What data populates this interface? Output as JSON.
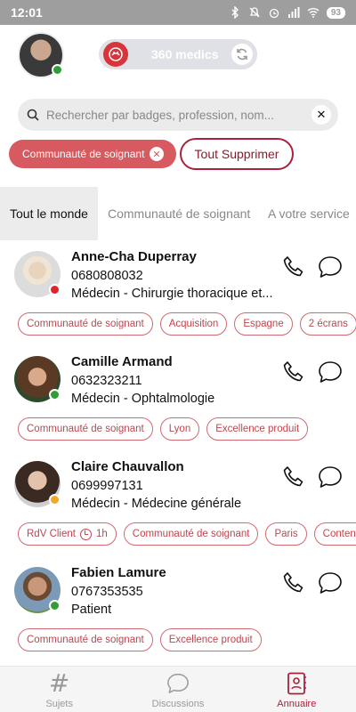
{
  "status_bar": {
    "time": "12:01",
    "battery": "93"
  },
  "header": {
    "medics_count_label": "360 medics"
  },
  "search": {
    "placeholder": "Rechercher par badges, profession, nom..."
  },
  "filters": {
    "active_chip": {
      "label": "Communauté de soignant"
    },
    "clear_all_label": "Tout Supprimer"
  },
  "tabs": [
    {
      "label": "Tout le monde",
      "active": true
    },
    {
      "label": "Communauté de soignant",
      "active": false
    },
    {
      "label": "A votre service",
      "active": false
    }
  ],
  "contacts": [
    {
      "name": "Anne-Cha Duperray",
      "phone": "0680808032",
      "job": "Médecin - Chirurgie thoracique et...",
      "status_color": "#e0242c",
      "badges": [
        "Communauté de soignant",
        "Acquisition",
        "Espagne",
        "2 écrans"
      ]
    },
    {
      "name": "Camille Armand",
      "phone": "0632323211",
      "job": "Médecin - Ophtalmologie",
      "status_color": "#2e9e35",
      "badges": [
        "Communauté de soignant",
        "Lyon",
        "Excellence produit"
      ]
    },
    {
      "name": "Claire Chauvallon",
      "phone": "0699997131",
      "job": "Médecin - Médecine générale",
      "status_color": "#f5a623",
      "timed_badge": {
        "label": "RdV Client",
        "duration": "1h"
      },
      "badges": [
        "Communauté de soignant",
        "Paris",
        "Contenu"
      ]
    },
    {
      "name": "Fabien Lamure",
      "phone": "0767353535",
      "job": "Patient",
      "status_color": "#2e9e35",
      "badges": [
        "Communauté de soignant",
        "Excellence produit"
      ]
    }
  ],
  "bottom_nav": [
    {
      "label": "Sujets",
      "icon": "hash-icon",
      "active": false
    },
    {
      "label": "Discussions",
      "icon": "chat-bubble-icon",
      "active": false
    },
    {
      "label": "Annuaire",
      "icon": "contacts-book-icon",
      "active": true
    }
  ],
  "colors": {
    "brand_red": "#a8233a",
    "chip_red": "#d65a5f",
    "online": "#2e9e35",
    "away": "#f5a623",
    "busy": "#e0242c"
  }
}
